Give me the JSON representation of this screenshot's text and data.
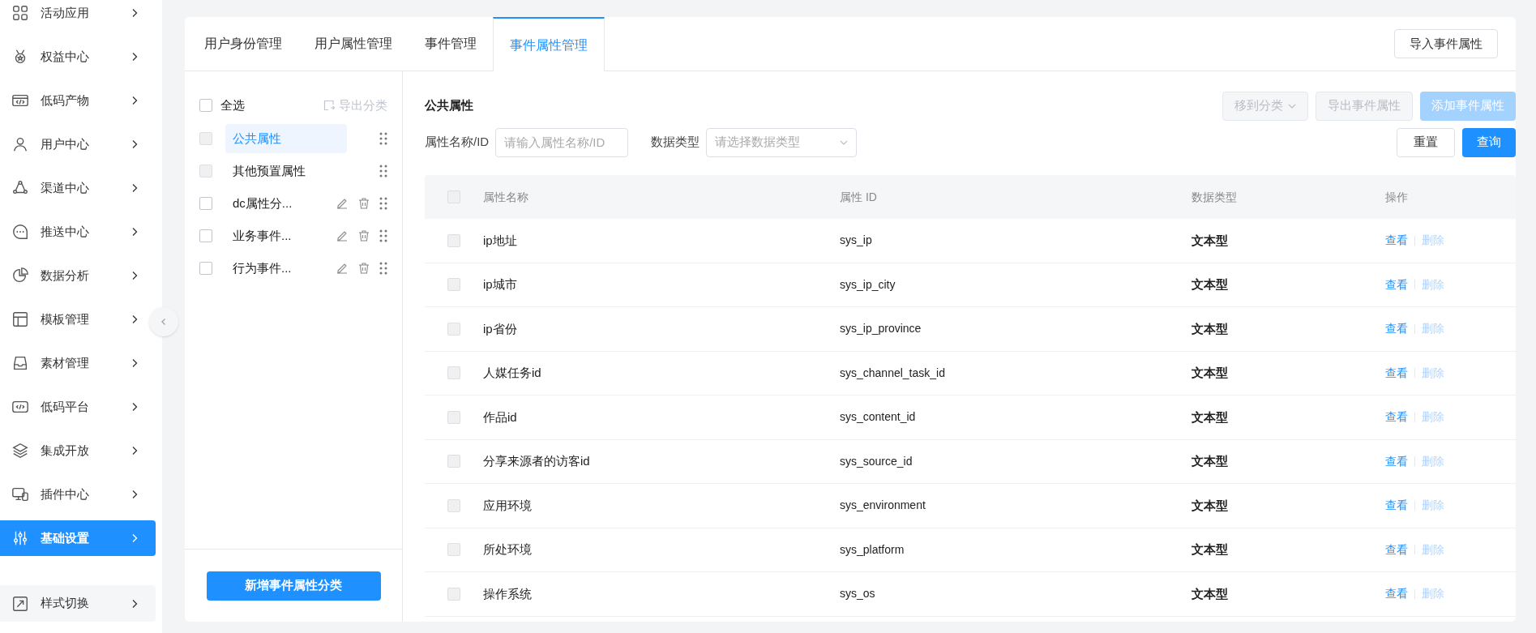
{
  "sidebar": {
    "items": [
      {
        "label": "活动应用",
        "selected": false
      },
      {
        "label": "权益中心",
        "selected": false
      },
      {
        "label": "低码产物",
        "selected": false
      },
      {
        "label": "用户中心",
        "selected": false
      },
      {
        "label": "渠道中心",
        "selected": false
      },
      {
        "label": "推送中心",
        "selected": false
      },
      {
        "label": "数据分析",
        "selected": false
      },
      {
        "label": "模板管理",
        "selected": false
      },
      {
        "label": "素材管理",
        "selected": false
      },
      {
        "label": "低码平台",
        "selected": false
      },
      {
        "label": "集成开放",
        "selected": false
      },
      {
        "label": "插件中心",
        "selected": false
      },
      {
        "label": "基础设置",
        "selected": true
      }
    ],
    "footer_item": {
      "label": "样式切换"
    }
  },
  "tabs": [
    {
      "label": "用户身份管理",
      "selected": false
    },
    {
      "label": "用户属性管理",
      "selected": false
    },
    {
      "label": "事件管理",
      "selected": false
    },
    {
      "label": "事件属性管理",
      "selected": true
    }
  ],
  "import_button": "导入事件属性",
  "categories": {
    "select_all": {
      "label": "全选",
      "checked": false
    },
    "export_button": {
      "label": "导出分类",
      "disabled": true
    },
    "items": [
      {
        "label": "公共属性",
        "selected": true,
        "checked": false,
        "disabled": true,
        "editable": false
      },
      {
        "label": "其他预置属性",
        "selected": false,
        "checked": false,
        "disabled": true,
        "editable": false
      },
      {
        "label": "dc属性分...",
        "selected": false,
        "checked": false,
        "disabled": false,
        "editable": true
      },
      {
        "label": "业务事件...",
        "selected": false,
        "checked": false,
        "disabled": false,
        "editable": true
      },
      {
        "label": "行为事件...",
        "selected": false,
        "checked": false,
        "disabled": false,
        "editable": true
      }
    ],
    "add_button": "新增事件属性分类"
  },
  "content": {
    "title": "公共属性",
    "toolbar": [
      {
        "label": "移到分类",
        "kind": "dropdown",
        "disabled": true
      },
      {
        "label": "导出事件属性",
        "kind": "plain",
        "disabled": true
      },
      {
        "label": "添加事件属性",
        "kind": "primary",
        "disabled": true
      }
    ],
    "filters": [
      {
        "label": "属性名称/ID",
        "kind": "input",
        "placeholder": "请输入属性名称/ID"
      },
      {
        "label": "数据类型",
        "kind": "select",
        "placeholder": "请选择数据类型"
      }
    ],
    "reset_button": "重置",
    "query_button": "查询"
  },
  "table": {
    "columns": [
      "属性名称",
      "属性 ID",
      "数据类型",
      "操作"
    ],
    "header_checkbox": {
      "checked": false,
      "disabled": true
    },
    "rows": [
      {
        "name": "ip地址",
        "id": "sys_ip",
        "type": "文本型",
        "checked": false,
        "disabled": true,
        "actions": [
          {
            "label": "查看",
            "disabled": false
          },
          {
            "label": "删除",
            "disabled": true
          }
        ]
      },
      {
        "name": "ip城市",
        "id": "sys_ip_city",
        "type": "文本型",
        "checked": false,
        "disabled": true,
        "actions": [
          {
            "label": "查看",
            "disabled": false
          },
          {
            "label": "删除",
            "disabled": true
          }
        ]
      },
      {
        "name": "ip省份",
        "id": "sys_ip_province",
        "type": "文本型",
        "checked": false,
        "disabled": true,
        "actions": [
          {
            "label": "查看",
            "disabled": false
          },
          {
            "label": "删除",
            "disabled": true
          }
        ]
      },
      {
        "name": "人媒任务id",
        "id": "sys_channel_task_id",
        "type": "文本型",
        "checked": false,
        "disabled": true,
        "actions": [
          {
            "label": "查看",
            "disabled": false
          },
          {
            "label": "删除",
            "disabled": true
          }
        ]
      },
      {
        "name": "作品id",
        "id": "sys_content_id",
        "type": "文本型",
        "checked": false,
        "disabled": true,
        "actions": [
          {
            "label": "查看",
            "disabled": false
          },
          {
            "label": "删除",
            "disabled": true
          }
        ]
      },
      {
        "name": "分享来源者的访客id",
        "id": "sys_source_id",
        "type": "文本型",
        "checked": false,
        "disabled": true,
        "actions": [
          {
            "label": "查看",
            "disabled": false
          },
          {
            "label": "删除",
            "disabled": true
          }
        ]
      },
      {
        "name": "应用环境",
        "id": "sys_environment",
        "type": "文本型",
        "checked": false,
        "disabled": true,
        "actions": [
          {
            "label": "查看",
            "disabled": false
          },
          {
            "label": "删除",
            "disabled": true
          }
        ]
      },
      {
        "name": "所处环境",
        "id": "sys_platform",
        "type": "文本型",
        "checked": false,
        "disabled": true,
        "actions": [
          {
            "label": "查看",
            "disabled": false
          },
          {
            "label": "删除",
            "disabled": true
          }
        ]
      },
      {
        "name": "操作系统",
        "id": "sys_os",
        "type": "文本型",
        "checked": false,
        "disabled": true,
        "actions": [
          {
            "label": "查看",
            "disabled": false
          },
          {
            "label": "删除",
            "disabled": true
          }
        ]
      }
    ]
  }
}
